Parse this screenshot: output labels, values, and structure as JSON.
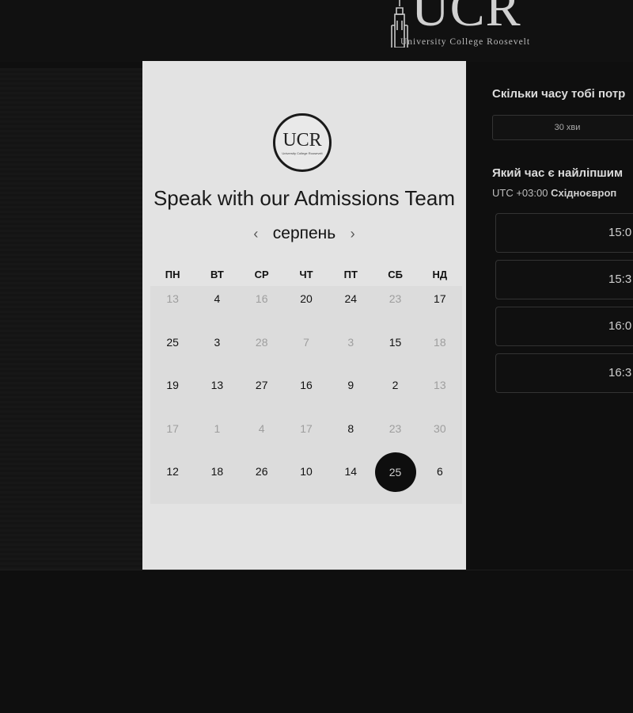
{
  "header": {
    "logo_text": "UCR",
    "logo_subtitle": "University College Roosevelt"
  },
  "card": {
    "logo_text": "UCR",
    "logo_subtitle": "University College Roosevelt",
    "title": "Speak with our Admissions Team",
    "month": "серпень",
    "prev_icon": "‹",
    "next_icon": "›",
    "weekdays": [
      "ПН",
      "ВТ",
      "СР",
      "ЧТ",
      "ПТ",
      "СБ",
      "НД"
    ],
    "days": [
      {
        "label": "13",
        "state": "muted"
      },
      {
        "label": "4",
        "state": "active"
      },
      {
        "label": "16",
        "state": "muted"
      },
      {
        "label": "20",
        "state": "active"
      },
      {
        "label": "24",
        "state": "active"
      },
      {
        "label": "23",
        "state": "muted"
      },
      {
        "label": "17",
        "state": "active"
      },
      {
        "label": "25",
        "state": "active"
      },
      {
        "label": "3",
        "state": "active"
      },
      {
        "label": "28",
        "state": "muted"
      },
      {
        "label": "7",
        "state": "muted"
      },
      {
        "label": "3",
        "state": "muted"
      },
      {
        "label": "15",
        "state": "active"
      },
      {
        "label": "18",
        "state": "muted"
      },
      {
        "label": "19",
        "state": "active"
      },
      {
        "label": "13",
        "state": "active"
      },
      {
        "label": "27",
        "state": "active"
      },
      {
        "label": "16",
        "state": "active"
      },
      {
        "label": "9",
        "state": "active"
      },
      {
        "label": "2",
        "state": "active"
      },
      {
        "label": "13",
        "state": "muted"
      },
      {
        "label": "17",
        "state": "muted"
      },
      {
        "label": "1",
        "state": "muted"
      },
      {
        "label": "4",
        "state": "muted"
      },
      {
        "label": "17",
        "state": "muted"
      },
      {
        "label": "8",
        "state": "active"
      },
      {
        "label": "23",
        "state": "muted"
      },
      {
        "label": "30",
        "state": "muted"
      },
      {
        "label": "12",
        "state": "active"
      },
      {
        "label": "18",
        "state": "active"
      },
      {
        "label": "26",
        "state": "active"
      },
      {
        "label": "10",
        "state": "active"
      },
      {
        "label": "14",
        "state": "active"
      },
      {
        "label": "25",
        "state": "selected"
      },
      {
        "label": "6",
        "state": "active"
      }
    ]
  },
  "booking": {
    "duration_question": "Скільки часу тобі потр",
    "duration_value": "30 хви",
    "time_question": "Який час є найліпшим",
    "timezone_offset": "UTC +03:00",
    "timezone_name": "Східноєвроп",
    "slots": [
      "15:0",
      "15:3",
      "16:0",
      "16:3"
    ]
  }
}
